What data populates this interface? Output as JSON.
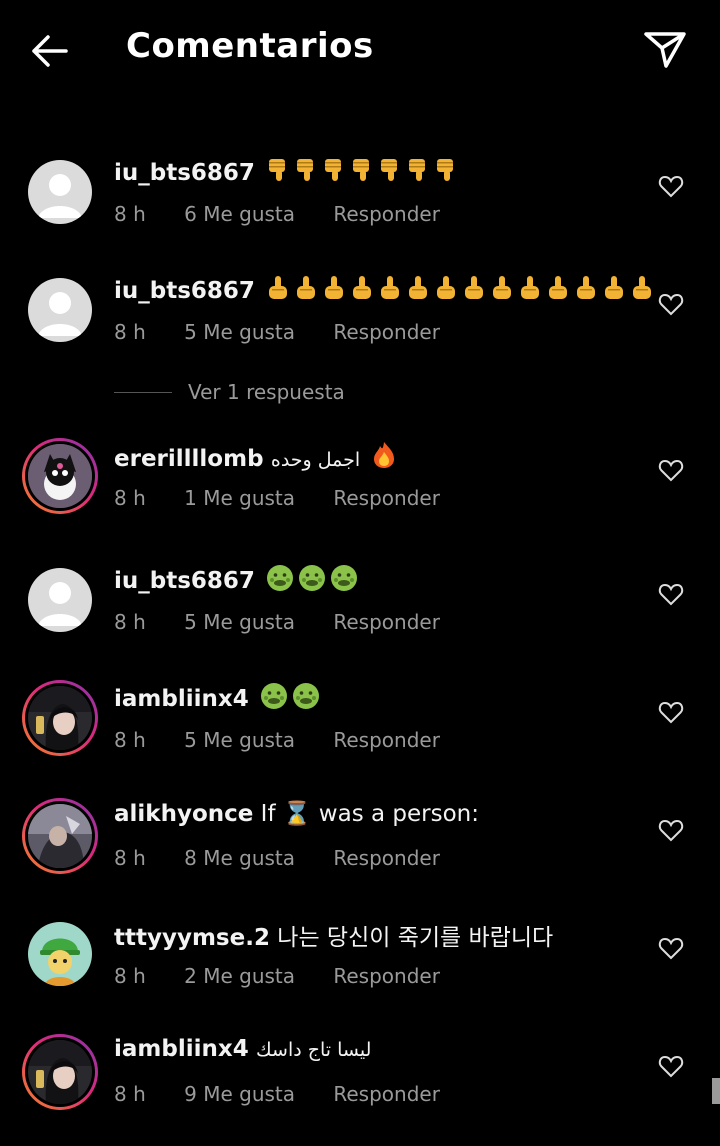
{
  "header": {
    "title": "Comentarios",
    "back_icon": "arrow-left-icon",
    "send_icon": "paper-plane-icon"
  },
  "colors": {
    "background": "#000000",
    "text": "#f3f3f3",
    "muted": "#9a9a9a",
    "ring_start": "#f58529",
    "ring_mid": "#dd2a7b",
    "ring_end": "#8134af"
  },
  "view_replies": "Ver 1 respuesta",
  "reply_label": "Responder",
  "comments": [
    {
      "user": "iu_bts6867",
      "text": "",
      "emoji": [
        "thumbs-down",
        "thumbs-down",
        "thumbs-down",
        "thumbs-down",
        "thumbs-down",
        "thumbs-down",
        "thumbs-down"
      ],
      "time": "8 h",
      "likes": "6 Me gusta",
      "avatar": "default"
    },
    {
      "user": "iu_bts6867",
      "text": "",
      "emoji": [
        "pointing-up",
        "pointing-up",
        "pointing-up",
        "pointing-up",
        "pointing-up",
        "pointing-up",
        "pointing-up",
        "pointing-up",
        "pointing-up",
        "pointing-up",
        "pointing-up",
        "pointing-up",
        "pointing-up",
        "pointing-up"
      ],
      "time": "8 h",
      "likes": "5 Me gusta",
      "avatar": "default"
    },
    {
      "user": "ererillllomb",
      "text": "اجمل وحده",
      "emoji": [
        "fire"
      ],
      "time": "8 h",
      "likes": "1 Me gusta",
      "avatar": "character-ring"
    },
    {
      "user": "iu_bts6867",
      "text": "",
      "emoji": [
        "nauseated",
        "nauseated",
        "nauseated"
      ],
      "time": "8 h",
      "likes": "5 Me gusta",
      "avatar": "default"
    },
    {
      "user": "iambliinx4",
      "text": "",
      "emoji": [
        "nauseated",
        "nauseated"
      ],
      "time": "8 h",
      "likes": "5 Me gusta",
      "avatar": "photo-ring"
    },
    {
      "user": "alikhyonce",
      "text": "If ⌛ was a person:",
      "emoji": [],
      "time": "8 h",
      "likes": "8 Me gusta",
      "avatar": "photo-ring"
    },
    {
      "user": "tttyyymse.2",
      "text": "나는 당신이 죽기를 바랍니다",
      "emoji": [],
      "time": "8 h",
      "likes": "2 Me gusta",
      "avatar": "cartoon"
    },
    {
      "user": "iambliinx4",
      "text": "ليسا تاج داسك",
      "emoji": [],
      "time": "8 h",
      "likes": "9 Me gusta",
      "avatar": "photo-ring"
    }
  ]
}
